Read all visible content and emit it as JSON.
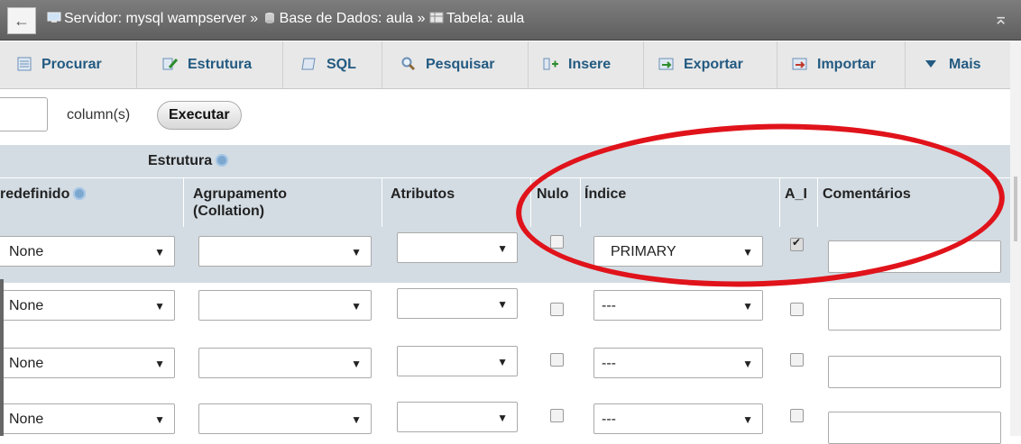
{
  "topbar": {
    "back": "←",
    "crumb_server": "Servidor: mysql wampserver",
    "sep": "»",
    "crumb_db": "Base de Dados: aula",
    "crumb_table": "Tabela: aula",
    "collapse": "⌅"
  },
  "tabs": [
    {
      "label": "Procurar",
      "icon": "browse-icon"
    },
    {
      "label": "Estrutura",
      "icon": "structure-icon"
    },
    {
      "label": "SQL",
      "icon": "sql-icon"
    },
    {
      "label": "Pesquisar",
      "icon": "search-icon"
    },
    {
      "label": "Insere",
      "icon": "insert-icon"
    },
    {
      "label": "Exportar",
      "icon": "export-icon"
    },
    {
      "label": "Importar",
      "icon": "import-icon"
    },
    {
      "label": "Mais",
      "icon": "triangle-down-icon"
    }
  ],
  "add_columns": {
    "label": "column(s)",
    "button": "Executar"
  },
  "section_title": "Estrutura",
  "headers": {
    "default": "redefinido",
    "collation_line1": "Agrupamento",
    "collation_line2": "(Collation)",
    "attributes": "Atributos",
    "null": "Nulo",
    "index": "Índice",
    "ai": "A_I",
    "comments": "Comentários"
  },
  "rows": [
    {
      "default": "None",
      "collation": "",
      "attributes": "",
      "null": false,
      "index": "PRIMARY",
      "ai": true,
      "comment": ""
    },
    {
      "default": "None",
      "collation": "",
      "attributes": "",
      "null": false,
      "index": "---",
      "ai": false,
      "comment": ""
    },
    {
      "default": "None",
      "collation": "",
      "attributes": "",
      "null": false,
      "index": "---",
      "ai": false,
      "comment": ""
    },
    {
      "default": "None",
      "collation": "",
      "attributes": "",
      "null": false,
      "index": "---",
      "ai": false,
      "comment": ""
    }
  ],
  "colors": {
    "accent_link": "#235a81",
    "annotation": "#e0131b",
    "row_highlight": "#d3dce3"
  }
}
